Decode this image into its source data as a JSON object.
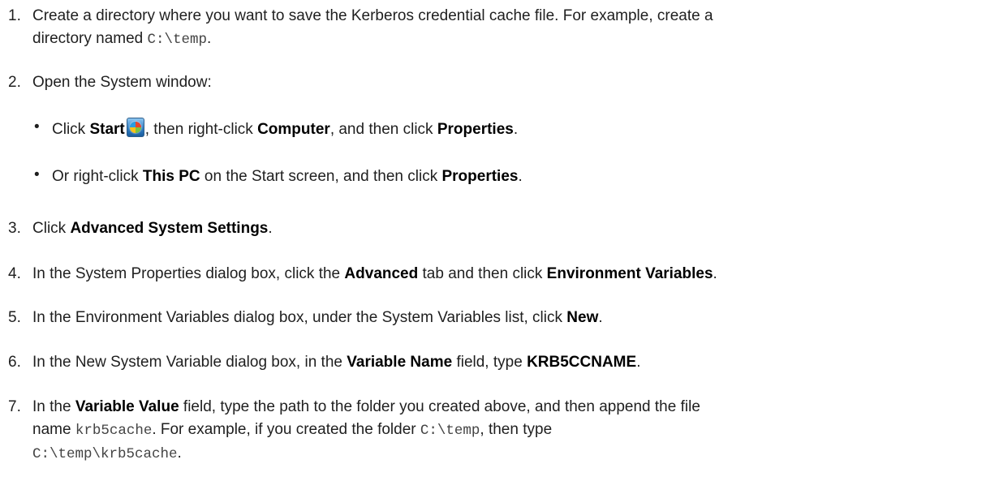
{
  "steps": [
    {
      "number": "1.",
      "line1": {
        "t1": "Create a directory where you want to save the Kerberos credential cache file. For example, create a"
      },
      "line2": {
        "t1": "directory named ",
        "code1": "C:\\temp",
        "t2": "."
      }
    },
    {
      "number": "2.",
      "text": "Open the System window:",
      "bullets": [
        {
          "marker": "•",
          "t1": "Click ",
          "b1": "Start",
          "icon": "windows-start-orb-icon",
          "t2": ", then right-click ",
          "b2": "Computer",
          "t3": ", and then click ",
          "b3": "Properties",
          "t4": "."
        },
        {
          "marker": "•",
          "t1": "Or right-click ",
          "b1": "This PC",
          "t2": " on the Start screen, and then click ",
          "b2": "Properties",
          "t3": "."
        }
      ]
    },
    {
      "number": "3.",
      "t1": "Click ",
      "b1": "Advanced System Settings",
      "t2": "."
    },
    {
      "number": "4.",
      "t1": "In the System Properties dialog box, click the ",
      "b1": "Advanced",
      "t2": " tab and then click ",
      "b2": "Environment Variables",
      "t3": "."
    },
    {
      "number": "5.",
      "t1": "In the Environment Variables dialog box, under the System Variables list, click ",
      "b1": "New",
      "t2": "."
    },
    {
      "number": "6.",
      "t1": "In the New System Variable dialog box, in the ",
      "b1": "Variable Name",
      "t2": " field, type ",
      "b2": "KRB5CCNAME",
      "t3": "."
    },
    {
      "number": "7.",
      "line1": {
        "t1": "In the ",
        "b1": "Variable Value",
        "t2": " field, type the path to the folder you created above, and then append the file"
      },
      "line2": {
        "t1": "name ",
        "code1": "krb5cache",
        "t2": ". For example, if you created the folder ",
        "code2": "C:\\temp",
        "t3": ", then type"
      },
      "line3": {
        "code1": "C:\\temp\\krb5cache",
        "t1": "."
      }
    }
  ],
  "colors": {
    "text": "#1f1f1f",
    "bold": "#000000",
    "code": "#444444"
  }
}
